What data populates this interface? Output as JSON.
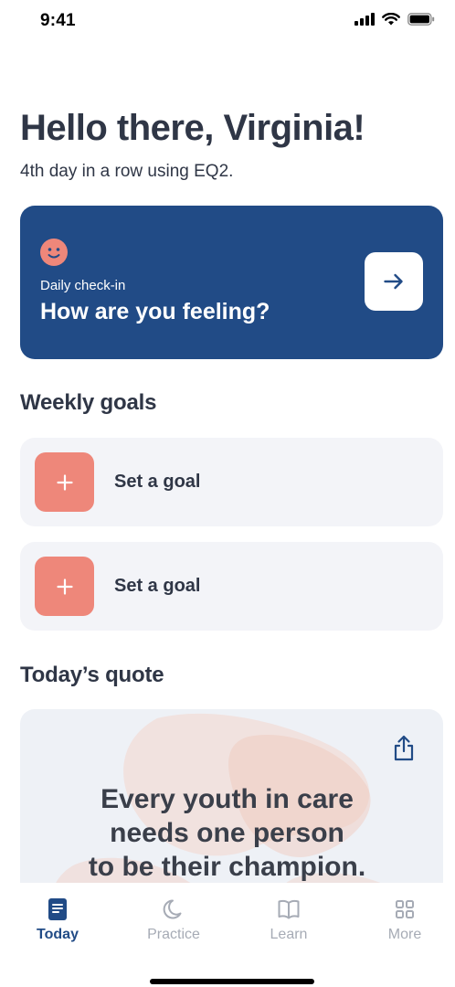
{
  "status_bar": {
    "time": "9:41",
    "icons": [
      "signal-icon",
      "wifi-icon",
      "battery-icon"
    ]
  },
  "header": {
    "greeting": "Hello there, Virginia!",
    "streak": "4th day in a row using EQ2."
  },
  "checkin": {
    "small_label": "Daily check-in",
    "title": "How are you feeling?",
    "icon": "smiley-face-icon",
    "action_icon": "arrow-right-icon"
  },
  "weekly_goals": {
    "title": "Weekly goals",
    "items": [
      {
        "label": "Set a goal",
        "icon": "plus-icon"
      },
      {
        "label": "Set a goal",
        "icon": "plus-icon"
      }
    ]
  },
  "quote": {
    "title": "Today’s quote",
    "lines": [
      "Every youth in care",
      "needs one person",
      "to be their champion."
    ],
    "action_icon": "share-icon"
  },
  "tabs": [
    {
      "label": "Today",
      "icon": "journal-icon",
      "active": true
    },
    {
      "label": "Practice",
      "icon": "moon-icon",
      "active": false
    },
    {
      "label": "Learn",
      "icon": "book-icon",
      "active": false
    },
    {
      "label": "More",
      "icon": "grid-icon",
      "active": false
    }
  ],
  "colors": {
    "primary": "#214b86",
    "accent": "#ee877a",
    "card_bg": "#f3f4f8",
    "text": "#2f3646",
    "inactive": "#a6abb5"
  }
}
